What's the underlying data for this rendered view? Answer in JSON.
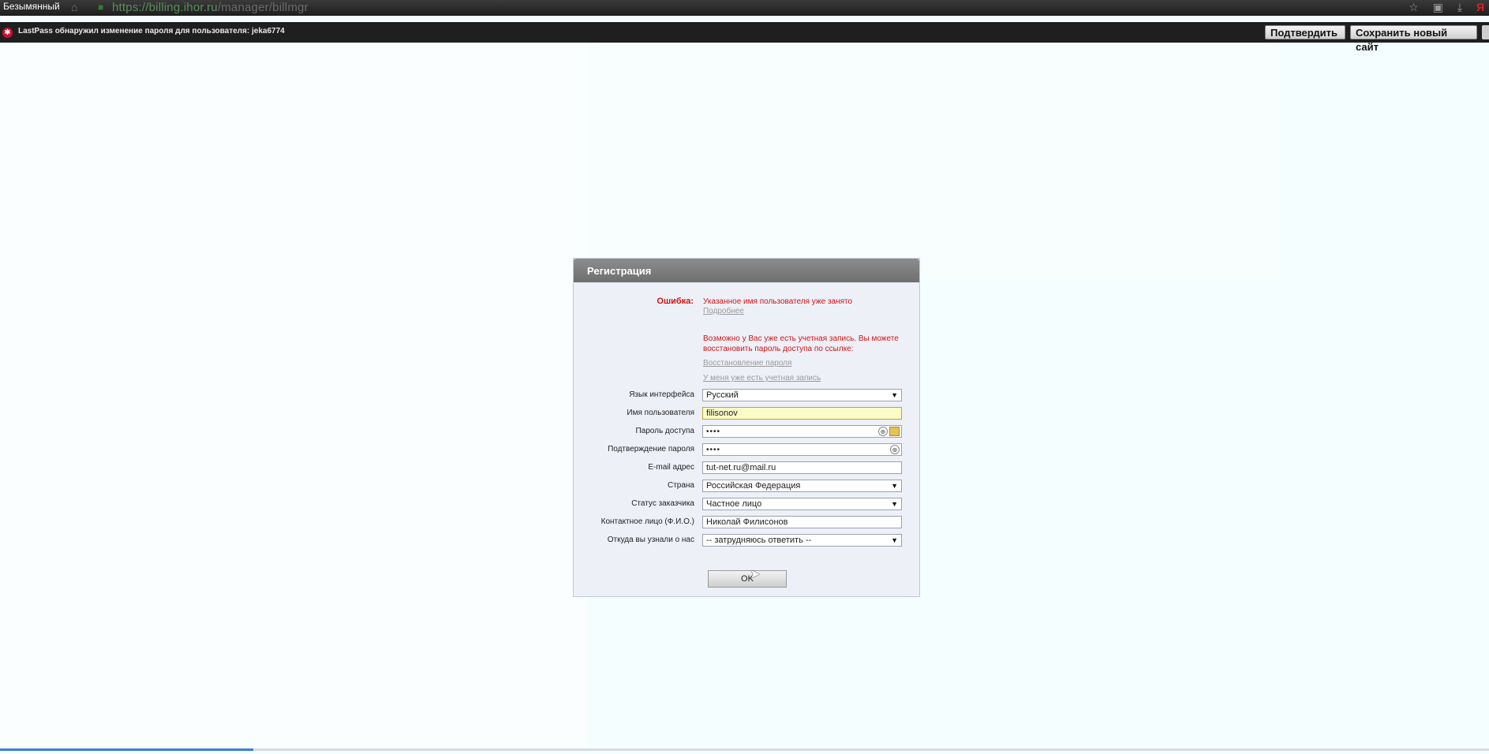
{
  "browser": {
    "tab_title": "Безымянный",
    "url_host": "https://billing.ihor.ru",
    "url_path": "/manager/billmgr"
  },
  "lastpass": {
    "message": "LastPass обнаружил изменение пароля для пользователя: jeka6774",
    "confirm_button": "Подтвердить",
    "save_button": "Сохранить новый сайт"
  },
  "dialog": {
    "title": "Регистрация",
    "error_label": "Ошибка:",
    "error_text": "Указанное имя пользователя уже занято",
    "more_link": "Подробнее",
    "account_hint": "Возможно у Вас уже есть учетная запись. Вы можете восстановить пароль доступа по ссылке:",
    "recover_link": "Восстановление пароля",
    "have_account_link": "У меня уже есть учетная запись",
    "fields": {
      "language": {
        "label": "Язык интерфейса",
        "value": "Русский"
      },
      "username": {
        "label": "Имя пользователя",
        "value": "filisonov"
      },
      "password": {
        "label": "Пароль доступа",
        "value": "••••"
      },
      "password_confirm": {
        "label": "Подтверждение пароля",
        "value": "••••"
      },
      "email": {
        "label": "E-mail адрес",
        "value": "tut-net.ru@mail.ru"
      },
      "country": {
        "label": "Страна",
        "value": "Российская Федерация"
      },
      "customer_status": {
        "label": "Статус заказчика",
        "value": "Частное лицо"
      },
      "contact": {
        "label": "Контактное лицо (Ф.И.О.)",
        "value": "Николай Филисонов"
      },
      "referral": {
        "label": "Откуда вы узнали о нас",
        "value": "-- затрудняюсь ответить --"
      }
    },
    "ok_button": "OK"
  },
  "page_load_progress": 0.17,
  "colors": {
    "error": "#d01414",
    "header": "#7d7d7d",
    "lastpass_bar": "#1f1f1f"
  }
}
